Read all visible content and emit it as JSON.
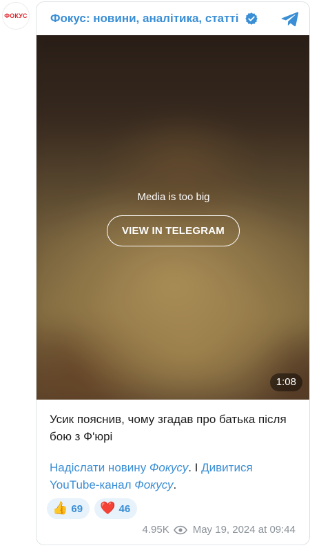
{
  "channel": {
    "avatar_text": "ФОКУС",
    "title": "Фокус: новини, аналітика, статті",
    "verified": true
  },
  "media": {
    "message": "Media is too big",
    "button_label": "VIEW IN TELEGRAM",
    "duration": "1:08"
  },
  "post": {
    "caption": "Усик пояснив, чому згадав про батька після бою з Ф'юрі",
    "link1_text": "Надіслати новину ",
    "link1_italic": "Фокусу",
    "separator": ". І ",
    "link2_text": "Дивитися YouTube-канал ",
    "link2_italic": "Фокусу",
    "end": "."
  },
  "reactions": [
    {
      "emoji": "👍",
      "count": "69"
    },
    {
      "emoji": "❤️",
      "count": "46"
    }
  ],
  "footer": {
    "views": "4.95K",
    "date": "May 19, 2024 at 09:44"
  },
  "colors": {
    "accent": "#3a8ed5",
    "brand_red": "#e0242c",
    "reaction_bg": "#e7f2fb",
    "muted": "#8b9299"
  }
}
